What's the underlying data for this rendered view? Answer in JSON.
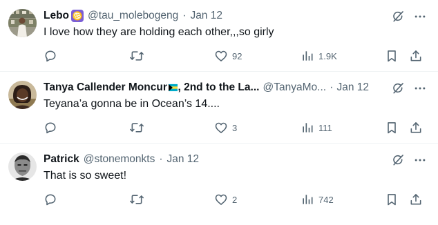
{
  "tweets": [
    {
      "name": "Lebo",
      "name_suffix": "",
      "zodiac_icon": "cancer-zodiac-icon",
      "handle": "@tau_molebogeng",
      "dot": "·",
      "date": "Jan 12",
      "text": "I love how they are holding each other,,,so girly",
      "reply_count": "",
      "retweet_count": "",
      "like_count": "92",
      "views": "1.9K"
    },
    {
      "name": "Tanya Callender Moncur",
      "name_suffix": ", 2nd to the La...",
      "flag_icon": "bahamas-flag-icon",
      "handle": "@TanyaMo...",
      "dot": "·",
      "date": "Jan 12",
      "text": "Teyana’a gonna be in Ocean’s 14....",
      "reply_count": "",
      "retweet_count": "",
      "like_count": "3",
      "views": "111"
    },
    {
      "name": "Patrick",
      "name_suffix": "",
      "handle": "@stonemonkts",
      "dot": "·",
      "date": "Jan 12",
      "text": "That is so sweet!",
      "reply_count": "",
      "retweet_count": "",
      "like_count": "2",
      "views": "742"
    }
  ],
  "colors": {
    "text": "#0f1419",
    "meta": "#536471",
    "divider": "#eff3f4"
  },
  "icons": [
    "reply-icon",
    "retweet-icon",
    "like-icon",
    "views-icon",
    "bookmark-icon",
    "share-icon",
    "grok-icon",
    "more-icon"
  ]
}
